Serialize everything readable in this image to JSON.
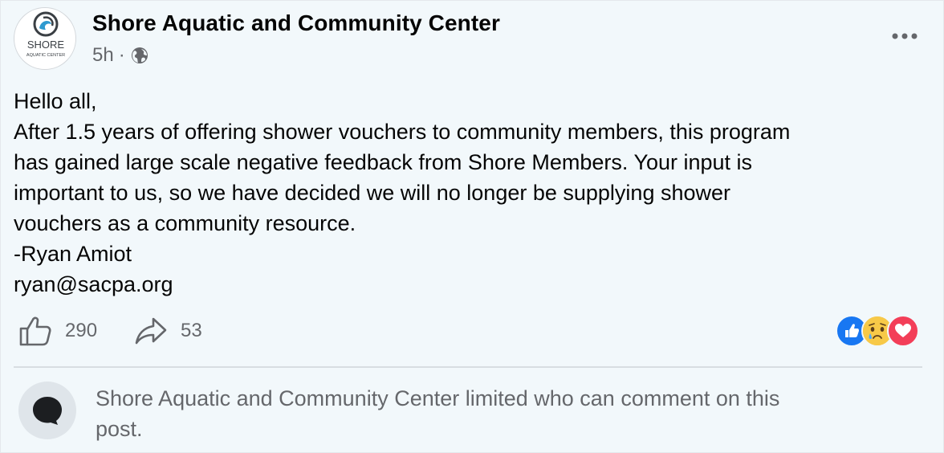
{
  "post": {
    "page_name": "Shore Aquatic and Community Center",
    "time": "5h",
    "separator": "·",
    "visibility_icon": "globe-icon",
    "more_icon": "more-options-icon",
    "avatar": {
      "logo_text": "SHORE",
      "logo_subtext": "AQUATIC CENTER"
    },
    "body_lines": [
      "Hello all,",
      "After 1.5 years of offering shower vouchers to community members, this program",
      "has gained large scale negative feedback from Shore Members. Your input is",
      "important to us, so we have decided we will no longer be supplying shower",
      "vouchers as a community resource.",
      "-Ryan Amiot",
      "ryan@sacpa.org"
    ]
  },
  "actions": {
    "like_count": "290",
    "share_count": "53",
    "like_icon": "thumbs-up-icon",
    "share_icon": "share-arrow-icon"
  },
  "reactions": {
    "items": [
      "like-reaction-icon",
      "sad-reaction-icon",
      "love-reaction-icon"
    ],
    "colors": {
      "like": "#1877f2",
      "sad": "#f7b125",
      "love": "#f33e58"
    }
  },
  "comments": {
    "restriction_line1": "Shore Aquatic and Community Center limited who can comment on this",
    "restriction_line2": "post.",
    "icon": "speech-bubble-icon"
  }
}
